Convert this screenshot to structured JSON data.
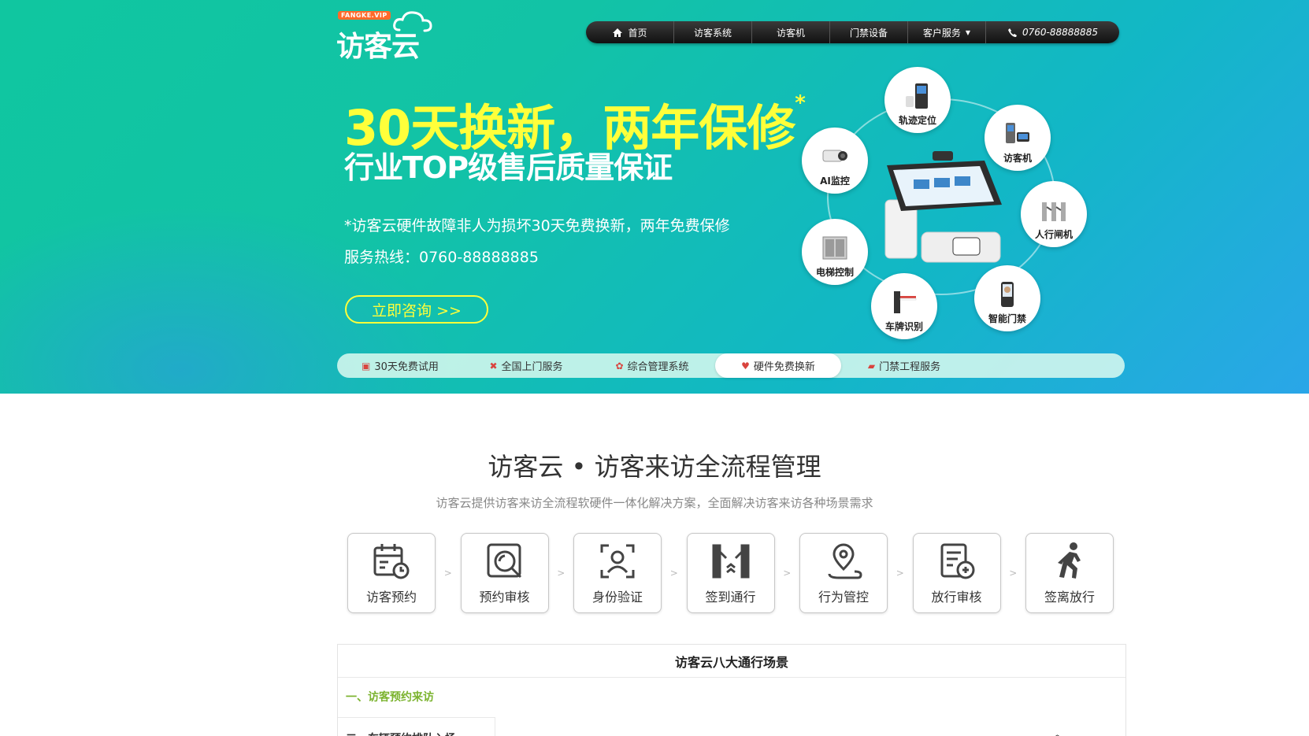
{
  "logo": {
    "badge": "FANGKE.VIP",
    "wordmark": "访客云"
  },
  "nav": {
    "items": [
      {
        "label": "首页",
        "icon": "home-icon"
      },
      {
        "label": "访客系统"
      },
      {
        "label": "访客机"
      },
      {
        "label": "门禁设备"
      },
      {
        "label": "客户服务",
        "icon": "dropdown-caret-icon"
      },
      {
        "label": "0760-88888885",
        "icon": "phone-icon"
      }
    ]
  },
  "hero": {
    "headline": "30天换新，两年保修",
    "headline_mark": "*",
    "subheadline": "行业TOP级售后质量保证",
    "note": "*访客云硬件故障非人为损坏30天免费换新，两年免费保修",
    "hotline": "服务热线：0760-88888885",
    "cta": "立即咨询 >>"
  },
  "products": [
    {
      "label": "轨迹定位",
      "icon": "kiosk-cabinet-icon"
    },
    {
      "label": "访客机",
      "icon": "visitor-terminal-icon"
    },
    {
      "label": "AI监控",
      "icon": "camera-icon"
    },
    {
      "label": "人行闸机",
      "icon": "turnstile-icon"
    },
    {
      "label": "电梯控制",
      "icon": "elevator-icon"
    },
    {
      "label": "智能门禁",
      "icon": "face-access-icon"
    },
    {
      "label": "车牌识别",
      "icon": "barrier-gate-icon"
    }
  ],
  "features": [
    {
      "label": "30天免费试用",
      "icon": "gift-icon"
    },
    {
      "label": "全国上门服务",
      "icon": "tools-icon"
    },
    {
      "label": "综合管理系统",
      "icon": "cog-icon"
    },
    {
      "label": "硬件免费换新",
      "icon": "heart-icon",
      "active": true
    },
    {
      "label": "门禁工程服务",
      "icon": "briefcase-icon"
    }
  ],
  "section": {
    "title": "访客云 • 访客来访全流程管理",
    "subtitle": "访客云提供访客来访全流程软硬件一体化解决方案，全面解决访客来访各种场景需求"
  },
  "steps": [
    {
      "label": "访客预约",
      "icon": "calendar-clock-icon"
    },
    {
      "label": "预约审核",
      "icon": "magnifier-review-icon"
    },
    {
      "label": "身份验证",
      "icon": "face-scan-icon"
    },
    {
      "label": "签到通行",
      "icon": "gate-pass-icon"
    },
    {
      "label": "行为管控",
      "icon": "location-pin-icon"
    },
    {
      "label": "放行审核",
      "icon": "document-approve-icon"
    },
    {
      "label": "签离放行",
      "icon": "walking-person-icon"
    }
  ],
  "step_separator": ">",
  "panel": {
    "title": "访客云八大通行场景",
    "category": "一、访客预约来访",
    "sub_item": "二、车辆预约排队入场"
  },
  "colors": {
    "hero_gradient_start": "#10c6a0",
    "hero_gradient_end": "#2aa6e8",
    "headline_yellow": "#ffff3a",
    "nav_dark": "#1a1a1a",
    "accent_green": "#7bb32e",
    "feature_icon_red": "#d9443e"
  }
}
